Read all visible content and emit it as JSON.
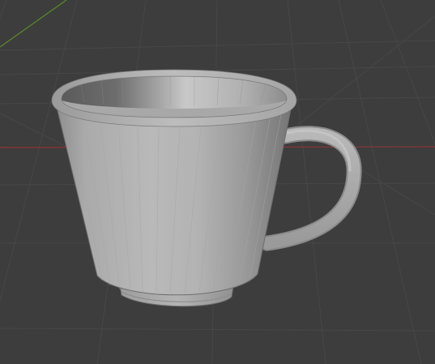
{
  "viewport": {
    "background": "#3d3d3d",
    "grid_minor_color": "#444444",
    "grid_major_color": "#4a4a4a",
    "axis_x_color": "#a33a3e",
    "axis_y_color": "#5e8a2c"
  },
  "scene": {
    "object": "cup-mesh",
    "shading": "solid",
    "object_color": "#b9b9b9"
  }
}
